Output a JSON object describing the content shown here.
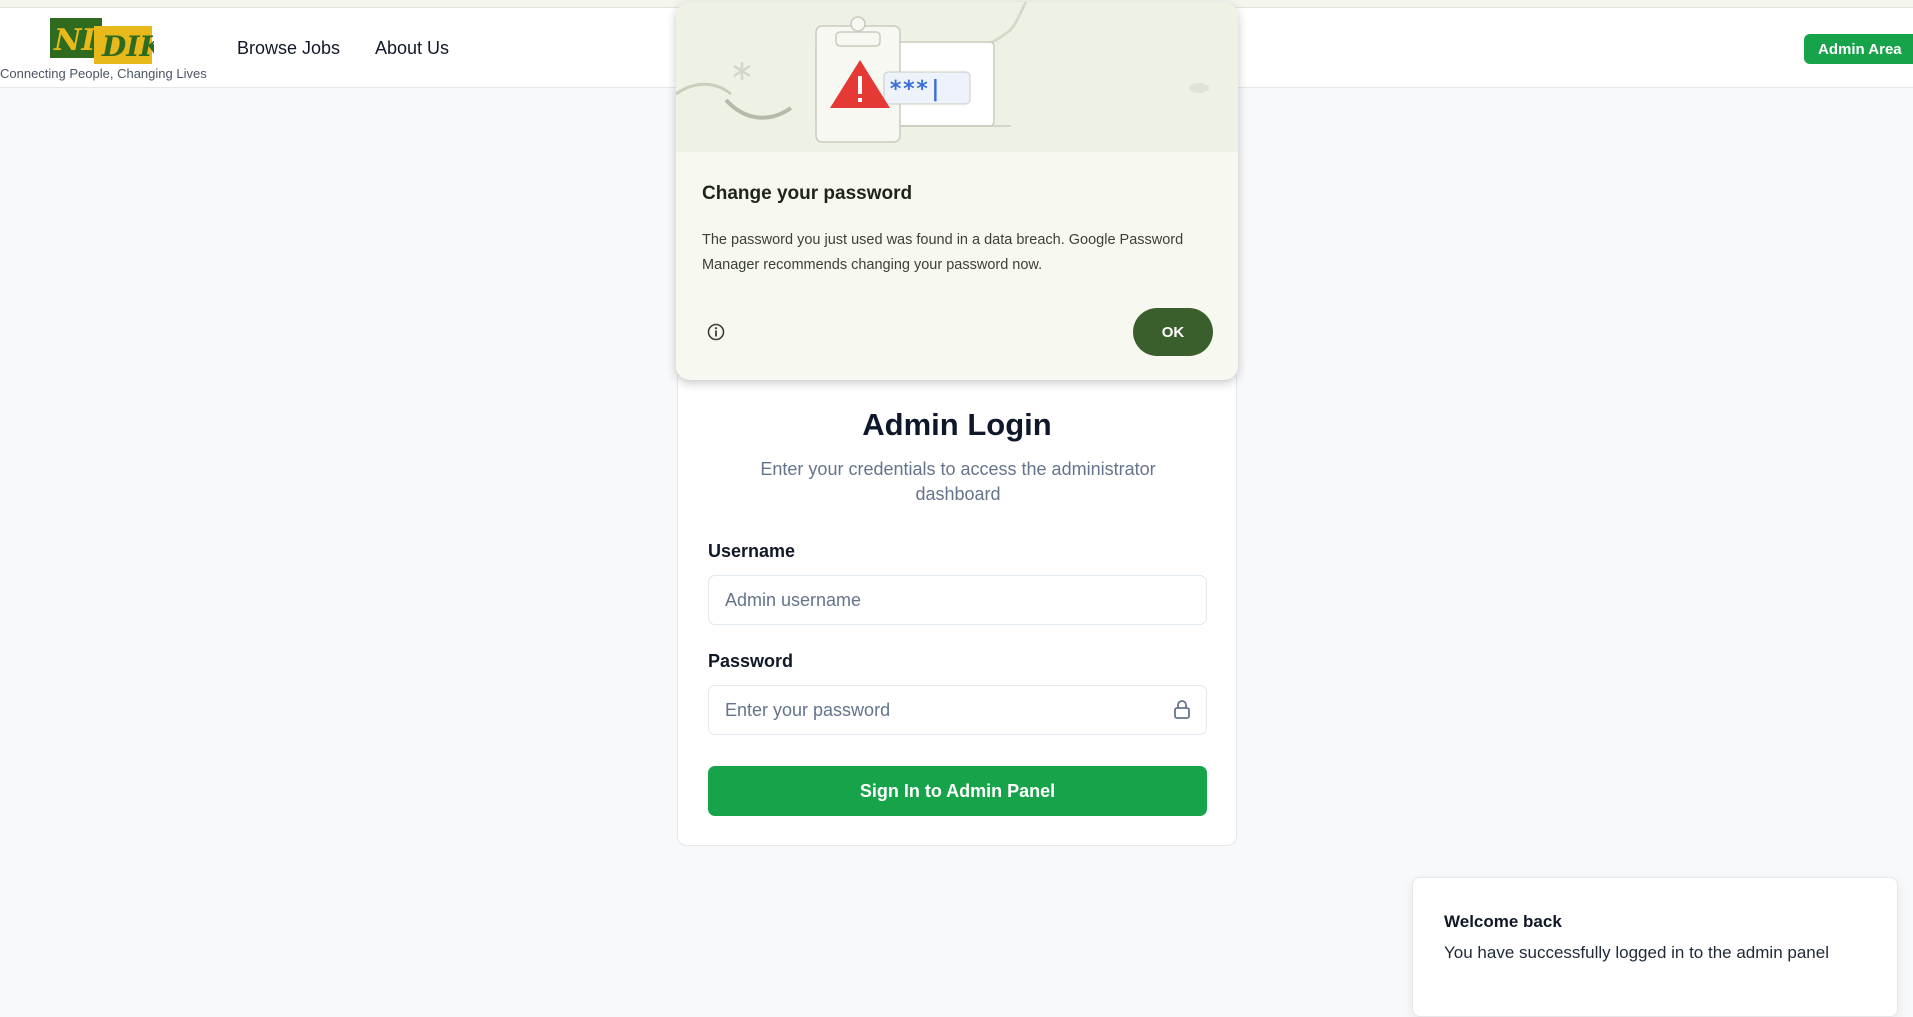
{
  "header": {
    "logo_text": "NICDIK",
    "tagline": "Connecting People, Changing Lives",
    "nav": {
      "browse_jobs": "Browse Jobs",
      "about_us": "About Us"
    },
    "admin_area": "Admin Area"
  },
  "breach_popup": {
    "illustration_text": "***|",
    "title": "Change your password",
    "body": "The password you just used was found in a data breach. Google Password Manager recommends changing your password now.",
    "info_icon": "info-circle-icon",
    "ok_label": "OK"
  },
  "login": {
    "title": "Admin Login",
    "subtitle": "Enter your credentials to access the administrator dashboard",
    "username_label": "Username",
    "username_placeholder": "Admin username",
    "password_label": "Password",
    "password_placeholder": "Enter your password",
    "lock_icon": "lock-icon",
    "submit_label": "Sign In to Admin Panel"
  },
  "toast": {
    "title": "Welcome back",
    "message": "You have successfully logged in to the admin panel"
  },
  "colors": {
    "brand_green": "#16a34a",
    "popup_ok": "#3a5f2c",
    "logo_green": "#2e6b1f",
    "logo_yellow": "#e8b91a"
  }
}
